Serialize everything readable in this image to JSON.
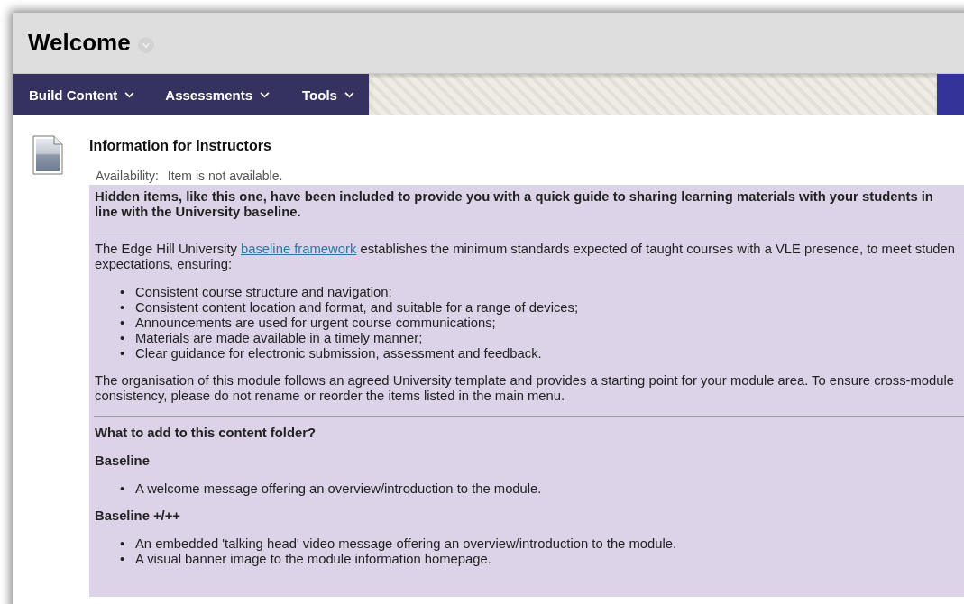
{
  "page": {
    "title": "Welcome"
  },
  "menu": [
    {
      "label": "Build Content"
    },
    {
      "label": "Assessments"
    },
    {
      "label": "Tools"
    }
  ],
  "item": {
    "title": "Information for Instructors",
    "availability_label": "Availability:",
    "availability_value": "Item is not available.",
    "intro_lines": [
      "Hidden items, like this one, have been included to provide you with a quick guide to sharing learning materials with your students in",
      "line with the University baseline."
    ],
    "framework_paragraph": {
      "before": "The Edge Hill University ",
      "link": "baseline framework",
      "after": " establishes the minimum standards expected of taught courses with a VLE presence, to meet studen",
      "line2": "expectations, ensuring:"
    },
    "ensuring_list": [
      {
        "marker": "•",
        "text": "Consistent course structure and navigation;"
      },
      {
        "marker": "•",
        "text": "Consistent content location and format, and suitable for a range of devices;"
      },
      {
        "marker": "•",
        "text": "Announcements are used for urgent course communications;"
      },
      {
        "marker": "•",
        "text": "Materials are made available in a timely manner;"
      },
      {
        "marker": "•",
        "text": "Clear guidance for electronic submission, assessment and feedback."
      }
    ],
    "organisation_lines": [
      "The organisation of this module follows an agreed University template and provides a starting point for your module area. To ensure cross-module",
      "consistency, please do not rename or reorder the items listed in the main menu."
    ],
    "question": "What to add to this content folder?",
    "sections": [
      {
        "heading": "Baseline",
        "items": [
          {
            "marker": "•",
            "text": "A welcome message offering an overview/introduction to the module."
          }
        ]
      },
      {
        "heading": "Baseline +/++",
        "items": [
          {
            "marker": "•",
            "text": "An embedded 'talking head' video message offering an overview/introduction to the module."
          },
          {
            "marker": "•",
            "text": "A visual banner image to the module information homepage."
          }
        ]
      }
    ]
  }
}
